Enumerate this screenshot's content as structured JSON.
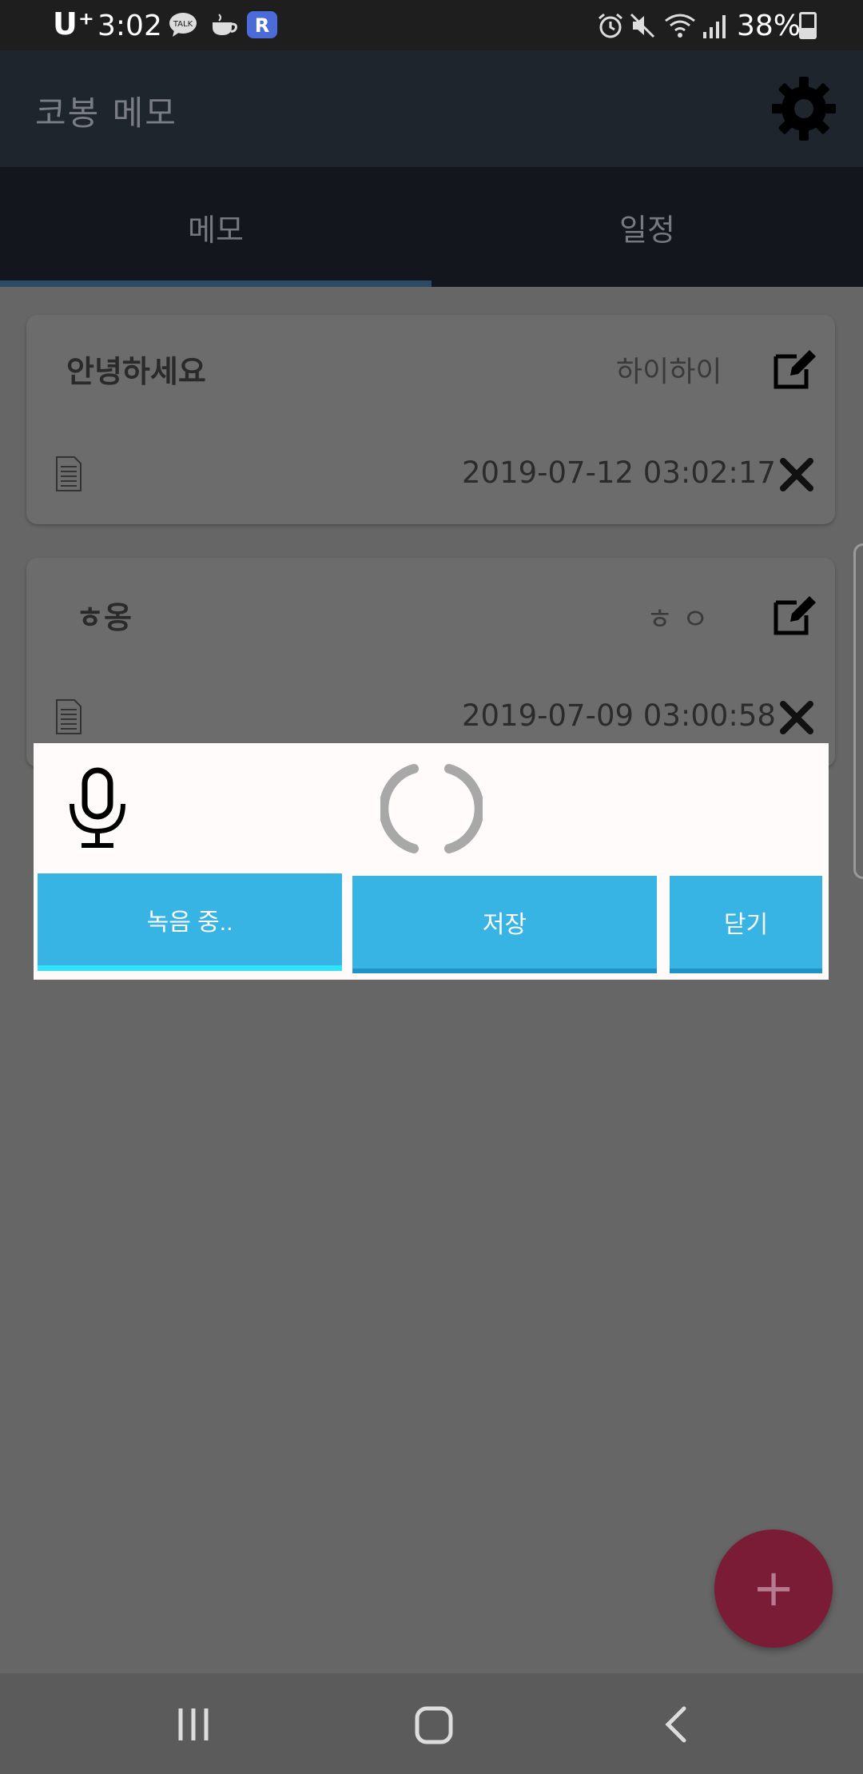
{
  "status_bar": {
    "carrier": "U⁺",
    "time": "3:02",
    "battery_percent": "38%",
    "notification_icons": [
      "talk-icon",
      "coffee-icon",
      "r-app-icon"
    ],
    "system_icons": [
      "alarm-icon",
      "mute-icon",
      "wifi-icon",
      "signal-icon",
      "battery-icon"
    ]
  },
  "app_bar": {
    "title": "코봉 메모",
    "settings_icon": "gear-icon"
  },
  "tabs": [
    {
      "label": "메모",
      "selected": true
    },
    {
      "label": "일정",
      "selected": false
    }
  ],
  "memos": [
    {
      "title": "안녕하세요",
      "content": "하이하이",
      "date": "2019-07-12 03:02:17"
    },
    {
      "title": "ㅎ옹",
      "content": "ㅎ ㅇ",
      "date": "2019-07-09 03:00:58"
    }
  ],
  "dialog": {
    "mic_icon": "microphone-icon",
    "record_label": "녹음 중..",
    "save_label": "저장",
    "close_label": "닫기"
  },
  "fab": {
    "label": "+"
  },
  "colors": {
    "button_accent": "#37b4e4",
    "fab": "#7a1c36",
    "scrim": "#666666"
  }
}
